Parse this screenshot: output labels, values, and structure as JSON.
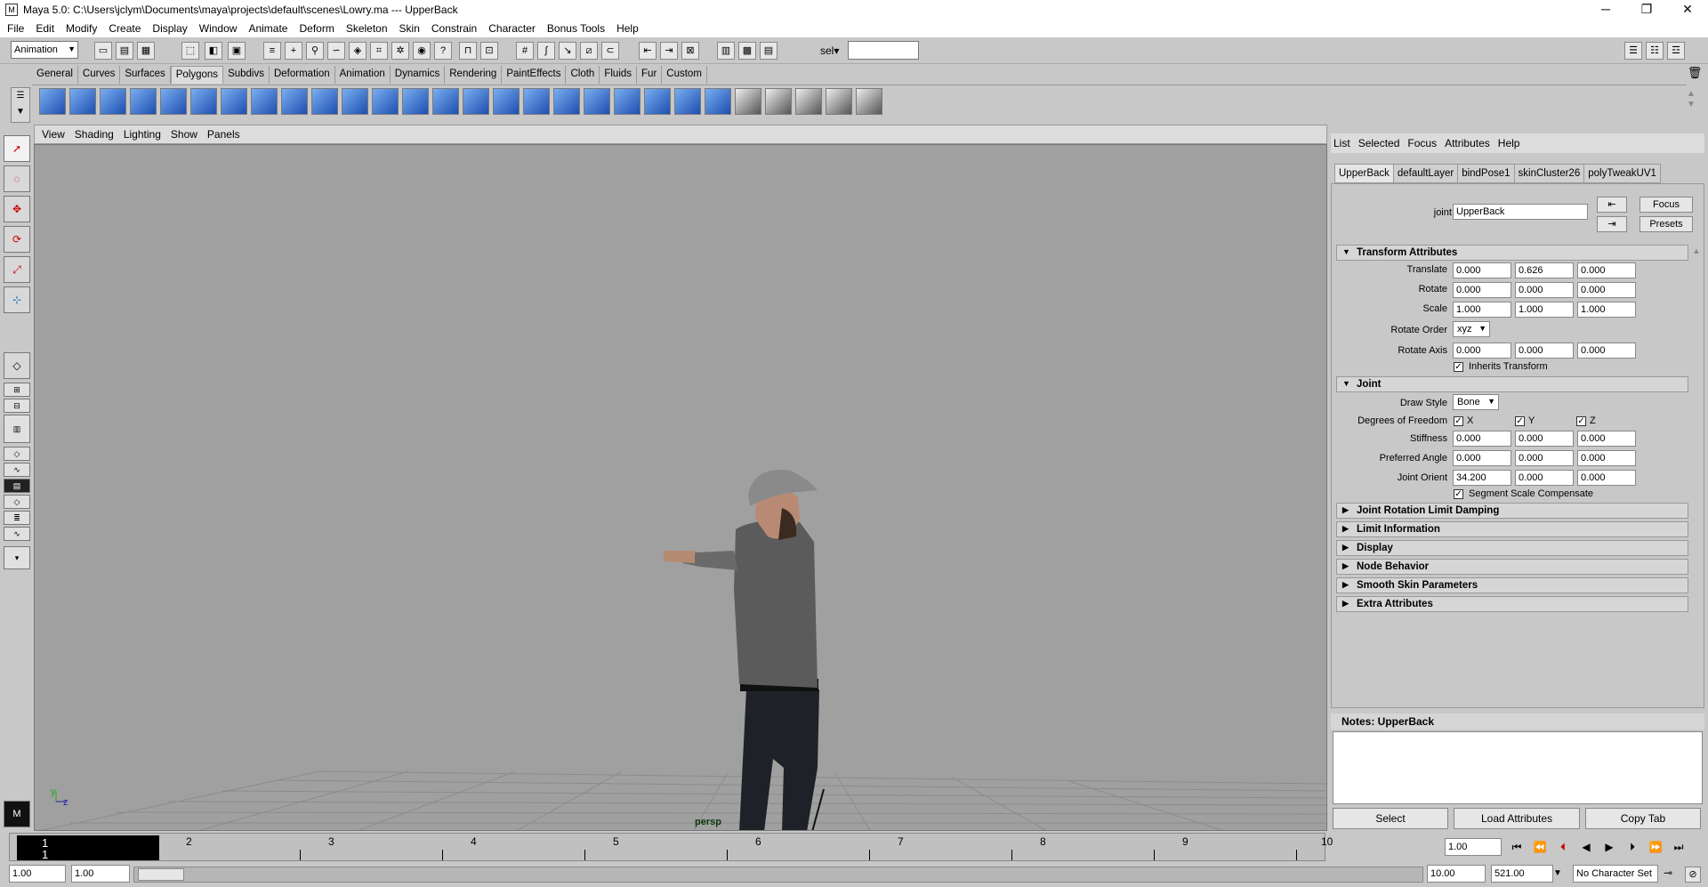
{
  "window": {
    "app_icon": "M",
    "title": "Maya 5.0: C:\\Users\\jclym\\Documents\\maya\\projects\\default\\scenes\\Lowry.ma  ---  UpperBack",
    "minimize": "─",
    "maximize": "❐",
    "close": "✕"
  },
  "menubar": [
    "File",
    "Edit",
    "Modify",
    "Create",
    "Display",
    "Window",
    "Animate",
    "Deform",
    "Skeleton",
    "Skin",
    "Constrain",
    "Character",
    "Bonus Tools",
    "Help"
  ],
  "statusline": {
    "mode": "Animation",
    "sel_label": "sel▾",
    "sel_value": ""
  },
  "shelf_tabs": [
    "General",
    "Curves",
    "Surfaces",
    "Polygons",
    "Subdivs",
    "Deformation",
    "Animation",
    "Dynamics",
    "Rendering",
    "PaintEffects",
    "Cloth",
    "Fluids",
    "Fur",
    "Custom"
  ],
  "shelf_active": "Polygons",
  "panel_menu": [
    "View",
    "Shading",
    "Lighting",
    "Show",
    "Panels"
  ],
  "viewport": {
    "camera": "persp",
    "axis_y": "y",
    "axis_z": "z"
  },
  "attribute_editor": {
    "menu": [
      "List",
      "Selected",
      "Focus",
      "Attributes",
      "Help"
    ],
    "tabs": [
      "UpperBack",
      "defaultLayer",
      "bindPose1",
      "skinCluster26",
      "polyTweakUV1"
    ],
    "node_label": "joint:",
    "node_name": "UpperBack",
    "focus_label": "Focus",
    "presets_label": "Presets",
    "transform": {
      "title": "Transform Attributes",
      "translate_label": "Translate",
      "translate": [
        "0.000",
        "0.626",
        "0.000"
      ],
      "rotate_label": "Rotate",
      "rotate": [
        "0.000",
        "0.000",
        "0.000"
      ],
      "scale_label": "Scale",
      "scale": [
        "1.000",
        "1.000",
        "1.000"
      ],
      "rotate_order_label": "Rotate Order",
      "rotate_order": "xyz",
      "rotate_axis_label": "Rotate Axis",
      "rotate_axis": [
        "0.000",
        "0.000",
        "0.000"
      ],
      "inherits_label": "Inherits Transform"
    },
    "joint": {
      "title": "Joint",
      "draw_style_label": "Draw Style",
      "draw_style": "Bone",
      "dof_label": "Degrees of Freedom",
      "dof": [
        "X",
        "Y",
        "Z"
      ],
      "stiffness_label": "Stiffness",
      "stiffness": [
        "0.000",
        "0.000",
        "0.000"
      ],
      "preferred_label": "Preferred Angle",
      "preferred": [
        "0.000",
        "0.000",
        "0.000"
      ],
      "orient_label": "Joint Orient",
      "orient": [
        "34.200",
        "0.000",
        "0.000"
      ],
      "ssc_label": "Segment Scale Compensate"
    },
    "collapsed_sections": [
      "Joint Rotation Limit Damping",
      "Limit Information",
      "Display",
      "Node Behavior",
      "Smooth Skin Parameters",
      "Extra Attributes"
    ],
    "notes_title": "Notes: UpperBack",
    "buttons": [
      "Select",
      "Load Attributes",
      "Copy Tab"
    ]
  },
  "timeline": {
    "current": "1",
    "current_sub": "1",
    "ticks": [
      "2",
      "3",
      "4",
      "5",
      "6",
      "7",
      "8",
      "9",
      "10"
    ],
    "current_time": "1.00"
  },
  "range": {
    "start": "1.00",
    "playback_start": "1.00",
    "playback_end": "10.00",
    "end": "521.00",
    "character_set": "No Character Set"
  }
}
